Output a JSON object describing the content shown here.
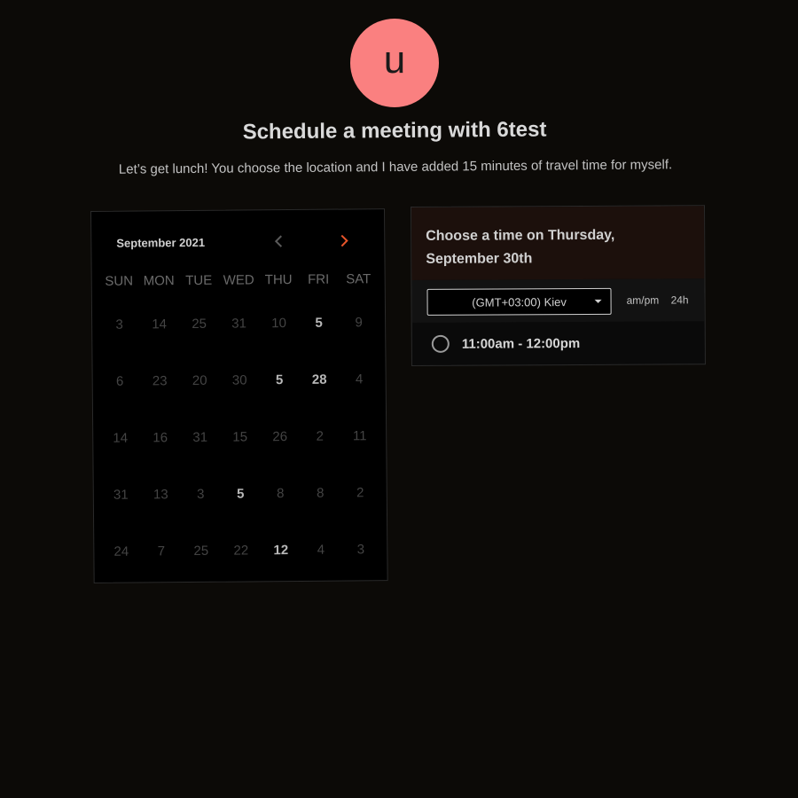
{
  "avatar": {
    "initial": "u",
    "color": "#fa8080"
  },
  "header": {
    "title": "Schedule a meeting with 6test",
    "description": "Let’s get lunch! You choose the location and I have added 15 minutes of travel time for myself."
  },
  "calendar": {
    "month_label": "September 2021",
    "prev_icon": "chevron-left-icon",
    "next_icon": "chevron-right-icon",
    "accent_color": "#e8552a",
    "weekdays": [
      "SUN",
      "MON",
      "TUE",
      "WED",
      "THU",
      "FRI",
      "SAT"
    ],
    "weeks": [
      [
        {
          "d": "3",
          "a": false
        },
        {
          "d": "14",
          "a": false
        },
        {
          "d": "25",
          "a": false
        },
        {
          "d": "31",
          "a": false
        },
        {
          "d": "10",
          "a": false
        },
        {
          "d": "5",
          "a": true
        },
        {
          "d": "9",
          "a": false
        }
      ],
      [
        {
          "d": "6",
          "a": false
        },
        {
          "d": "23",
          "a": false
        },
        {
          "d": "20",
          "a": false
        },
        {
          "d": "30",
          "a": false
        },
        {
          "d": "5",
          "a": true
        },
        {
          "d": "28",
          "a": true
        },
        {
          "d": "4",
          "a": false
        }
      ],
      [
        {
          "d": "14",
          "a": false
        },
        {
          "d": "16",
          "a": false
        },
        {
          "d": "31",
          "a": false
        },
        {
          "d": "15",
          "a": false
        },
        {
          "d": "26",
          "a": false
        },
        {
          "d": "2",
          "a": false
        },
        {
          "d": "11",
          "a": false
        }
      ],
      [
        {
          "d": "31",
          "a": false
        },
        {
          "d": "13",
          "a": false
        },
        {
          "d": "3",
          "a": false
        },
        {
          "d": "5",
          "a": true
        },
        {
          "d": "8",
          "a": false
        },
        {
          "d": "8",
          "a": false
        },
        {
          "d": "2",
          "a": false
        }
      ],
      [
        {
          "d": "24",
          "a": false
        },
        {
          "d": "7",
          "a": false
        },
        {
          "d": "25",
          "a": false
        },
        {
          "d": "22",
          "a": false
        },
        {
          "d": "12",
          "a": true
        },
        {
          "d": "4",
          "a": false
        },
        {
          "d": "3",
          "a": false
        }
      ]
    ]
  },
  "times": {
    "heading": "Choose a time on Thursday, September 30th",
    "timezone": "(GMT+03:00) Kiev",
    "format_ampm": "am/pm",
    "format_24h": "24h",
    "slots": [
      "11:00am - 12:00pm"
    ]
  }
}
